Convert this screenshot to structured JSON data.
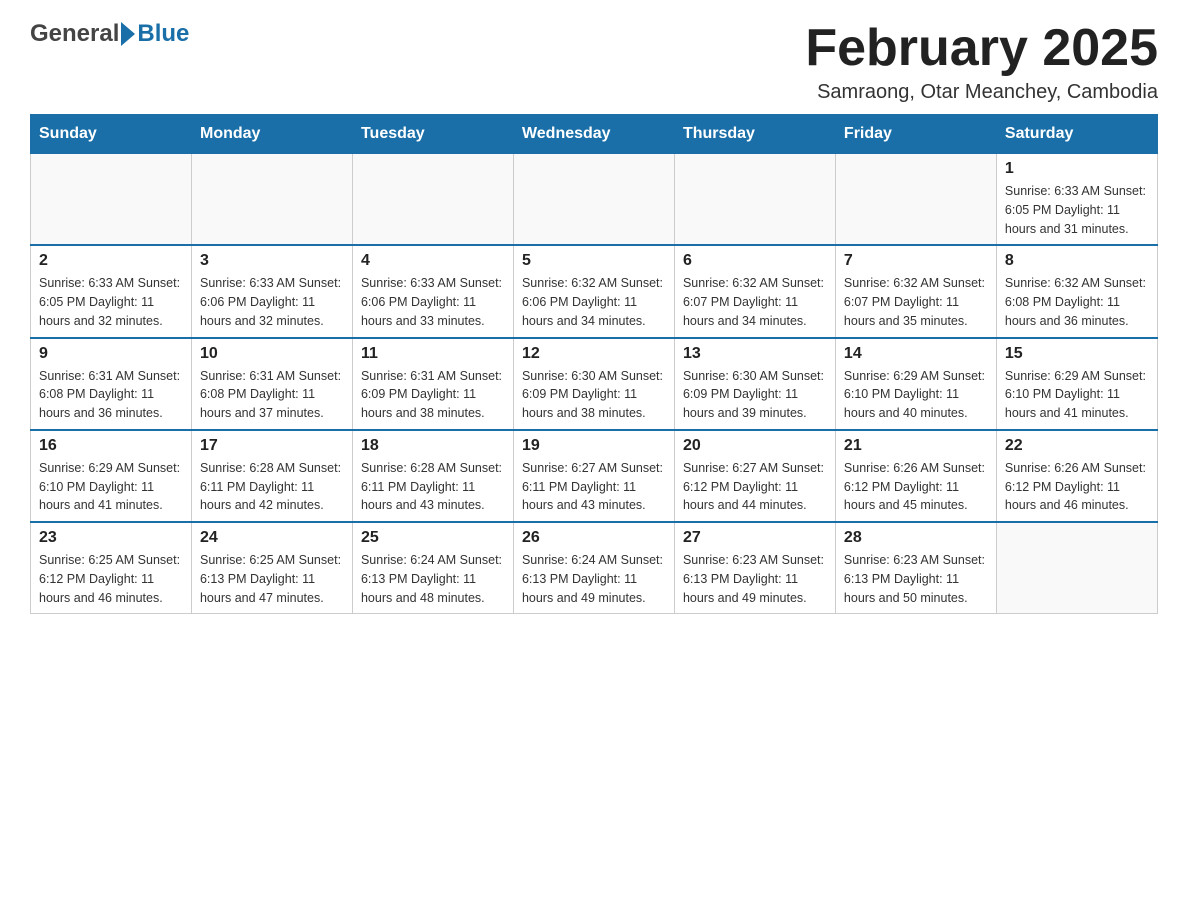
{
  "header": {
    "logo": {
      "general": "General",
      "blue": "Blue"
    },
    "title": "February 2025",
    "location": "Samraong, Otar Meanchey, Cambodia"
  },
  "calendar": {
    "days_of_week": [
      "Sunday",
      "Monday",
      "Tuesday",
      "Wednesday",
      "Thursday",
      "Friday",
      "Saturday"
    ],
    "weeks": [
      [
        {
          "day": "",
          "info": ""
        },
        {
          "day": "",
          "info": ""
        },
        {
          "day": "",
          "info": ""
        },
        {
          "day": "",
          "info": ""
        },
        {
          "day": "",
          "info": ""
        },
        {
          "day": "",
          "info": ""
        },
        {
          "day": "1",
          "info": "Sunrise: 6:33 AM\nSunset: 6:05 PM\nDaylight: 11 hours and 31 minutes."
        }
      ],
      [
        {
          "day": "2",
          "info": "Sunrise: 6:33 AM\nSunset: 6:05 PM\nDaylight: 11 hours and 32 minutes."
        },
        {
          "day": "3",
          "info": "Sunrise: 6:33 AM\nSunset: 6:06 PM\nDaylight: 11 hours and 32 minutes."
        },
        {
          "day": "4",
          "info": "Sunrise: 6:33 AM\nSunset: 6:06 PM\nDaylight: 11 hours and 33 minutes."
        },
        {
          "day": "5",
          "info": "Sunrise: 6:32 AM\nSunset: 6:06 PM\nDaylight: 11 hours and 34 minutes."
        },
        {
          "day": "6",
          "info": "Sunrise: 6:32 AM\nSunset: 6:07 PM\nDaylight: 11 hours and 34 minutes."
        },
        {
          "day": "7",
          "info": "Sunrise: 6:32 AM\nSunset: 6:07 PM\nDaylight: 11 hours and 35 minutes."
        },
        {
          "day": "8",
          "info": "Sunrise: 6:32 AM\nSunset: 6:08 PM\nDaylight: 11 hours and 36 minutes."
        }
      ],
      [
        {
          "day": "9",
          "info": "Sunrise: 6:31 AM\nSunset: 6:08 PM\nDaylight: 11 hours and 36 minutes."
        },
        {
          "day": "10",
          "info": "Sunrise: 6:31 AM\nSunset: 6:08 PM\nDaylight: 11 hours and 37 minutes."
        },
        {
          "day": "11",
          "info": "Sunrise: 6:31 AM\nSunset: 6:09 PM\nDaylight: 11 hours and 38 minutes."
        },
        {
          "day": "12",
          "info": "Sunrise: 6:30 AM\nSunset: 6:09 PM\nDaylight: 11 hours and 38 minutes."
        },
        {
          "day": "13",
          "info": "Sunrise: 6:30 AM\nSunset: 6:09 PM\nDaylight: 11 hours and 39 minutes."
        },
        {
          "day": "14",
          "info": "Sunrise: 6:29 AM\nSunset: 6:10 PM\nDaylight: 11 hours and 40 minutes."
        },
        {
          "day": "15",
          "info": "Sunrise: 6:29 AM\nSunset: 6:10 PM\nDaylight: 11 hours and 41 minutes."
        }
      ],
      [
        {
          "day": "16",
          "info": "Sunrise: 6:29 AM\nSunset: 6:10 PM\nDaylight: 11 hours and 41 minutes."
        },
        {
          "day": "17",
          "info": "Sunrise: 6:28 AM\nSunset: 6:11 PM\nDaylight: 11 hours and 42 minutes."
        },
        {
          "day": "18",
          "info": "Sunrise: 6:28 AM\nSunset: 6:11 PM\nDaylight: 11 hours and 43 minutes."
        },
        {
          "day": "19",
          "info": "Sunrise: 6:27 AM\nSunset: 6:11 PM\nDaylight: 11 hours and 43 minutes."
        },
        {
          "day": "20",
          "info": "Sunrise: 6:27 AM\nSunset: 6:12 PM\nDaylight: 11 hours and 44 minutes."
        },
        {
          "day": "21",
          "info": "Sunrise: 6:26 AM\nSunset: 6:12 PM\nDaylight: 11 hours and 45 minutes."
        },
        {
          "day": "22",
          "info": "Sunrise: 6:26 AM\nSunset: 6:12 PM\nDaylight: 11 hours and 46 minutes."
        }
      ],
      [
        {
          "day": "23",
          "info": "Sunrise: 6:25 AM\nSunset: 6:12 PM\nDaylight: 11 hours and 46 minutes."
        },
        {
          "day": "24",
          "info": "Sunrise: 6:25 AM\nSunset: 6:13 PM\nDaylight: 11 hours and 47 minutes."
        },
        {
          "day": "25",
          "info": "Sunrise: 6:24 AM\nSunset: 6:13 PM\nDaylight: 11 hours and 48 minutes."
        },
        {
          "day": "26",
          "info": "Sunrise: 6:24 AM\nSunset: 6:13 PM\nDaylight: 11 hours and 49 minutes."
        },
        {
          "day": "27",
          "info": "Sunrise: 6:23 AM\nSunset: 6:13 PM\nDaylight: 11 hours and 49 minutes."
        },
        {
          "day": "28",
          "info": "Sunrise: 6:23 AM\nSunset: 6:13 PM\nDaylight: 11 hours and 50 minutes."
        },
        {
          "day": "",
          "info": ""
        }
      ]
    ]
  }
}
